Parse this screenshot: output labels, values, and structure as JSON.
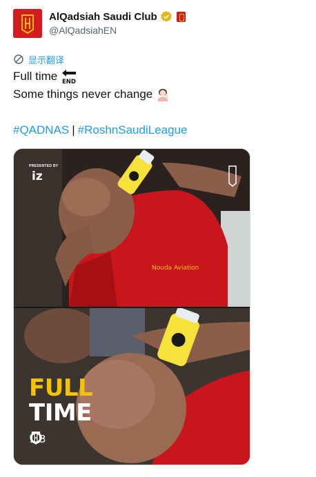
{
  "account": {
    "display_name": "AlQadsiah Saudi Club",
    "handle": "@AlQadsiahEN"
  },
  "translate": {
    "label": "显示翻译"
  },
  "tweet": {
    "line1": "Full time",
    "line1_emoji_name": "end-arrow-emoji",
    "line2": "Some things never change",
    "line2_emoji_name": "person-raising-hand-emoji",
    "hashtags": [
      "#QADNAS",
      "#RoshnSaudiLeague"
    ],
    "hashtag_separator": "|"
  },
  "media": {
    "presented_by": "PRESENTED BY",
    "sponsor": "iz",
    "headline_top": "FULL",
    "headline_bottom": "TIME",
    "score": "1-3",
    "colors": {
      "full": "#f5c400",
      "time": "#ffffff",
      "kit_red": "#d71920",
      "drink_yellow": "#f5e23a"
    }
  },
  "colors": {
    "link": "#1d9bf0",
    "muted": "#536471",
    "text": "#0f1419",
    "brand": "#d71920"
  }
}
